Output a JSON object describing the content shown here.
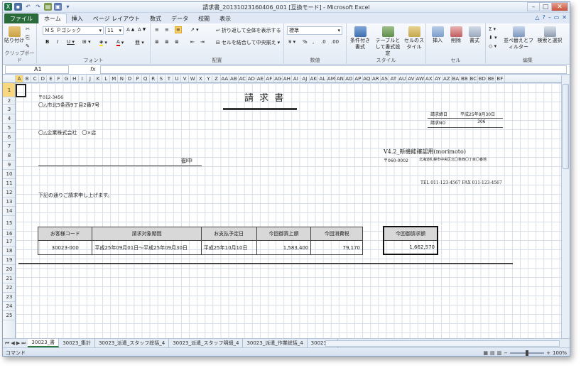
{
  "window": {
    "title": "請求書_20131023160406_001 [互換モード] - Microsoft Excel"
  },
  "ribbon": {
    "tabs": [
      "ファイル",
      "ホーム",
      "挿入",
      "ページ レイアウト",
      "数式",
      "データ",
      "校閲",
      "表示"
    ],
    "clipboard": {
      "paste": "貼り付け",
      "label": "クリップボード"
    },
    "font": {
      "name": "ＭＳ Ｐゴシック",
      "size": "11",
      "label": "フォント"
    },
    "alignment": {
      "wrap": "折り返して全体を表示する",
      "merge": "セルを結合して中央揃え",
      "label": "配置"
    },
    "number": {
      "format": "標準",
      "label": "数値"
    },
    "styles": {
      "conditional": "条件付き書式",
      "table": "テーブルとして書式設定",
      "cell": "セルのスタイル",
      "label": "スタイル"
    },
    "cells": {
      "insert": "挿入",
      "delete": "削除",
      "format": "書式",
      "label": "セル"
    },
    "editing": {
      "sort": "並べ替えとフィルター",
      "find": "検索と選択",
      "label": "編集"
    }
  },
  "formula_bar": {
    "name_box": "A1",
    "fx": "fx",
    "content": ""
  },
  "columns": [
    "A",
    "B",
    "C",
    "D",
    "E",
    "F",
    "G",
    "H",
    "I",
    "J",
    "K",
    "L",
    "M",
    "N",
    "O",
    "P",
    "Q",
    "R",
    "S",
    "T",
    "U",
    "V",
    "W",
    "X",
    "Y",
    "Z",
    "AA",
    "AB",
    "AC",
    "AD",
    "AE",
    "AF",
    "AG",
    "AH",
    "AI",
    "AJ",
    "AK",
    "AL",
    "AM",
    "AN",
    "AO",
    "AP",
    "AQ",
    "AR",
    "AS",
    "AT",
    "AU",
    "AV",
    "AW",
    "AX",
    "AY",
    "AZ",
    "BA",
    "BB",
    "BC",
    "BD",
    "BE",
    "BF"
  ],
  "rows": [
    "1",
    "2",
    "3",
    "4",
    "5",
    "6",
    "7",
    "8",
    "9",
    "10",
    "11",
    "12",
    "13",
    "14",
    "15",
    "16",
    "17",
    "18",
    "19",
    "20",
    "21",
    "22",
    "23",
    "24",
    "25"
  ],
  "invoice": {
    "title": "請 求 書",
    "postal_code": "〒012-3456",
    "address": "〇△市北5条西9丁目2番7号",
    "customer": "〇△企業株式会社　〇×店",
    "honorific": "御中",
    "intro": "下記の通りご請求申し上げます。",
    "issue_date_label": "請求締日",
    "issue_date_value": "平成25年9月30日",
    "invoice_no_label": "請求NO",
    "invoice_no_value": "306",
    "sender_name": "V4.2_新機能確認用(morimoto)",
    "sender_postal": "〒060-0002",
    "sender_address": "北海道札幌市中央区北〇条西〇丁目〇番地",
    "sender_phone": "TEL 011-123-4567 FAX 011-123-4567",
    "table_headers": [
      "お客様コード",
      "請求対象期間",
      "お支払予定日",
      "今回御買上額",
      "今回消費税"
    ],
    "table_row": [
      "30023-000",
      "平成25年09月01日～平成25年09月30日",
      "平成25年10月10日",
      "1,583,400",
      "79,170"
    ],
    "total_header": "今回御請求額",
    "total_value": "1,662,570"
  },
  "sheet_tabs": [
    "30023_書",
    "30023_集計",
    "30023_派遣_スタッフ総括_4",
    "30023_派遣_スタッフ明細_4",
    "30023_派遣_作業総括_4",
    "30023_派"
  ],
  "status": {
    "mode": "コマンド",
    "zoom": "100%"
  }
}
